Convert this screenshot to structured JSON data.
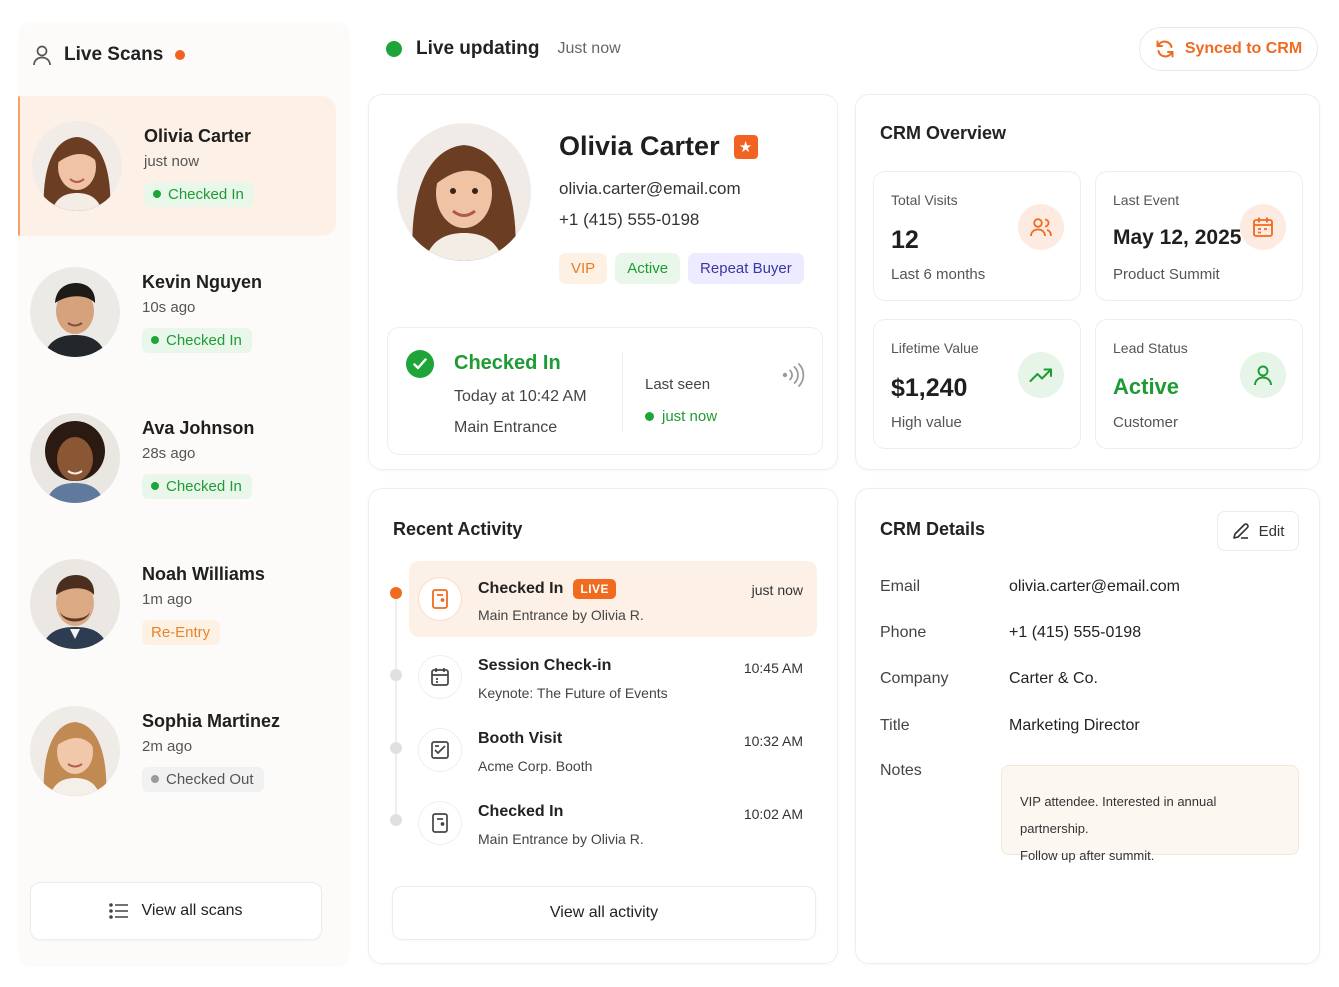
{
  "sidebar": {
    "title": "Live Scans",
    "scans": [
      {
        "name": "Olivia Carter",
        "time": "just now",
        "status": "Checked In"
      },
      {
        "name": "Kevin Nguyen",
        "time": "10s ago",
        "status": "Checked In"
      },
      {
        "name": "Ava Johnson",
        "time": "28s ago",
        "status": "Checked In"
      },
      {
        "name": "Noah Williams",
        "time": "1m ago",
        "status": "Re-Entry"
      },
      {
        "name": "Sophia Martinez",
        "time": "2m ago",
        "status": "Checked Out"
      }
    ],
    "view_all": "View all scans"
  },
  "topbar": {
    "live": "Live updating",
    "updated": "Just now",
    "synced": "Synced to CRM"
  },
  "profile": {
    "name": "Olivia Carter",
    "email": "olivia.carter@email.com",
    "phone": "+1 (415) 555-0198",
    "tags": [
      "VIP",
      "Active",
      "Repeat Buyer"
    ],
    "checkin": {
      "title": "Checked In",
      "time": "Today at 10:42 AM",
      "location": "Main Entrance",
      "last_seen_label": "Last seen",
      "last_seen_value": "just now"
    }
  },
  "overview": {
    "title": "CRM Overview",
    "stats": [
      {
        "label": "Total Visits",
        "value": "12",
        "sub": "Last 6 months",
        "icon": "users-icon"
      },
      {
        "label": "Last Event",
        "value": "May 12, 2025",
        "sub": "Product Summit",
        "icon": "calendar-icon"
      },
      {
        "label": "Lifetime Value",
        "value": "$1,240",
        "sub": "High value",
        "icon": "trending-up-icon"
      },
      {
        "label": "Lead Status",
        "value": "Active",
        "sub": "Customer",
        "icon": "user-icon"
      }
    ]
  },
  "activity": {
    "title": "Recent Activity",
    "live_label": "LIVE",
    "items": [
      {
        "title": "Checked In",
        "sub": "Main Entrance by Olivia R.",
        "time": "just now",
        "live": true
      },
      {
        "title": "Session Check-in",
        "sub": "Keynote: The Future of Events",
        "time": "10:45 AM"
      },
      {
        "title": "Booth Visit",
        "sub": "Acme Corp. Booth",
        "time": "10:32 AM"
      },
      {
        "title": "Checked In",
        "sub": "Main Entrance by Olivia R.",
        "time": "10:02 AM"
      }
    ],
    "view_all": "View all activity"
  },
  "details": {
    "title": "CRM Details",
    "edit": "Edit",
    "fields": [
      {
        "label": "Email",
        "value": "olivia.carter@email.com"
      },
      {
        "label": "Phone",
        "value": "+1 (415) 555-0198"
      },
      {
        "label": "Company",
        "value": "Carter & Co."
      },
      {
        "label": "Title",
        "value": "Marketing Director"
      }
    ],
    "notes_label": "Notes",
    "notes_line1": "VIP attendee. Interested in annual partnership.",
    "notes_line2": "Follow up after summit."
  },
  "colors": {
    "accent": "#f06a1f",
    "green": "#1e9b34",
    "purple": "#3c36a5"
  }
}
